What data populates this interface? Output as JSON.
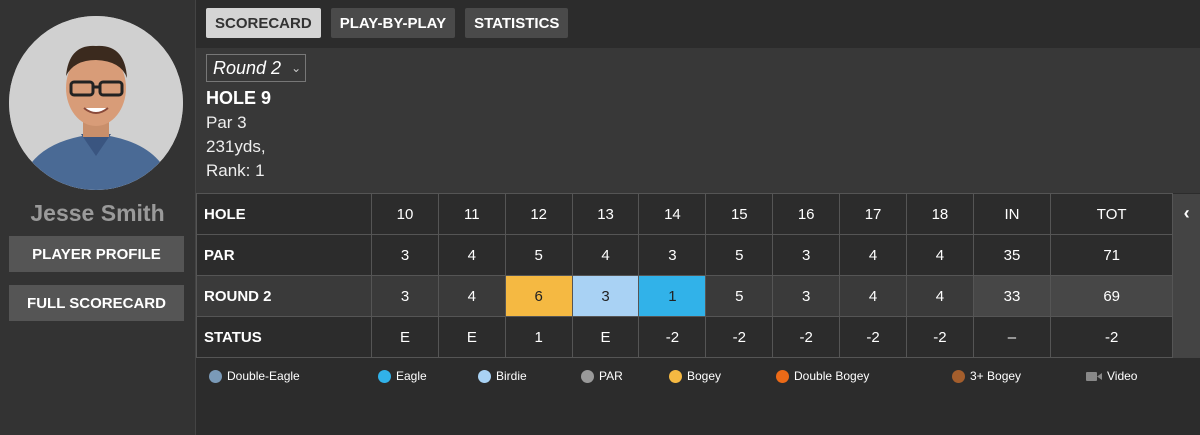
{
  "player": {
    "name": "Jesse Smith",
    "profile_button": "PLAYER PROFILE",
    "full_scorecard_button": "FULL SCORECARD"
  },
  "tabs": [
    {
      "label": "SCORECARD",
      "active": true
    },
    {
      "label": "PLAY-BY-PLAY",
      "active": false
    },
    {
      "label": "STATISTICS",
      "active": false
    }
  ],
  "hole_info": {
    "round_selected": "Round 2",
    "hole_title": "HOLE 9",
    "par": "Par 3",
    "yards": "231yds,",
    "rank": "Rank: 1"
  },
  "scorecard": {
    "header": {
      "label": "HOLE",
      "holes": [
        "10",
        "11",
        "12",
        "13",
        "14",
        "15",
        "16",
        "17",
        "18"
      ],
      "in": "IN",
      "tot": "TOT"
    },
    "par": {
      "label": "PAR",
      "values": [
        "3",
        "4",
        "5",
        "4",
        "3",
        "5",
        "3",
        "4",
        "4"
      ],
      "in": "35",
      "tot": "71"
    },
    "round": {
      "label": "ROUND 2",
      "values": [
        "3",
        "4",
        "6",
        "3",
        "1",
        "5",
        "3",
        "4",
        "4"
      ],
      "in": "33",
      "tot": "69",
      "highlights": [
        "",
        "",
        "#f5b942",
        "#a9d2f4",
        "#31b2e9",
        "",
        "",
        "",
        ""
      ]
    },
    "status": {
      "label": "STATUS",
      "values": [
        "E",
        "E",
        "1",
        "E",
        "-2",
        "-2",
        "-2",
        "-2",
        "-2"
      ],
      "in": "–",
      "tot": "-2"
    }
  },
  "legend": [
    {
      "label": "Double-Eagle",
      "color": "#7a9ab8"
    },
    {
      "label": "Eagle",
      "color": "#31b2e9"
    },
    {
      "label": "Birdie",
      "color": "#a9d2f4"
    },
    {
      "label": "PAR",
      "color": "#999999"
    },
    {
      "label": "Bogey",
      "color": "#f5b942"
    },
    {
      "label": "Double Bogey",
      "color": "#ec6a17"
    },
    {
      "label": "3+ Bogey",
      "color": "#a45e2c"
    },
    {
      "label": "Video",
      "icon": "video-camera-icon"
    }
  ]
}
